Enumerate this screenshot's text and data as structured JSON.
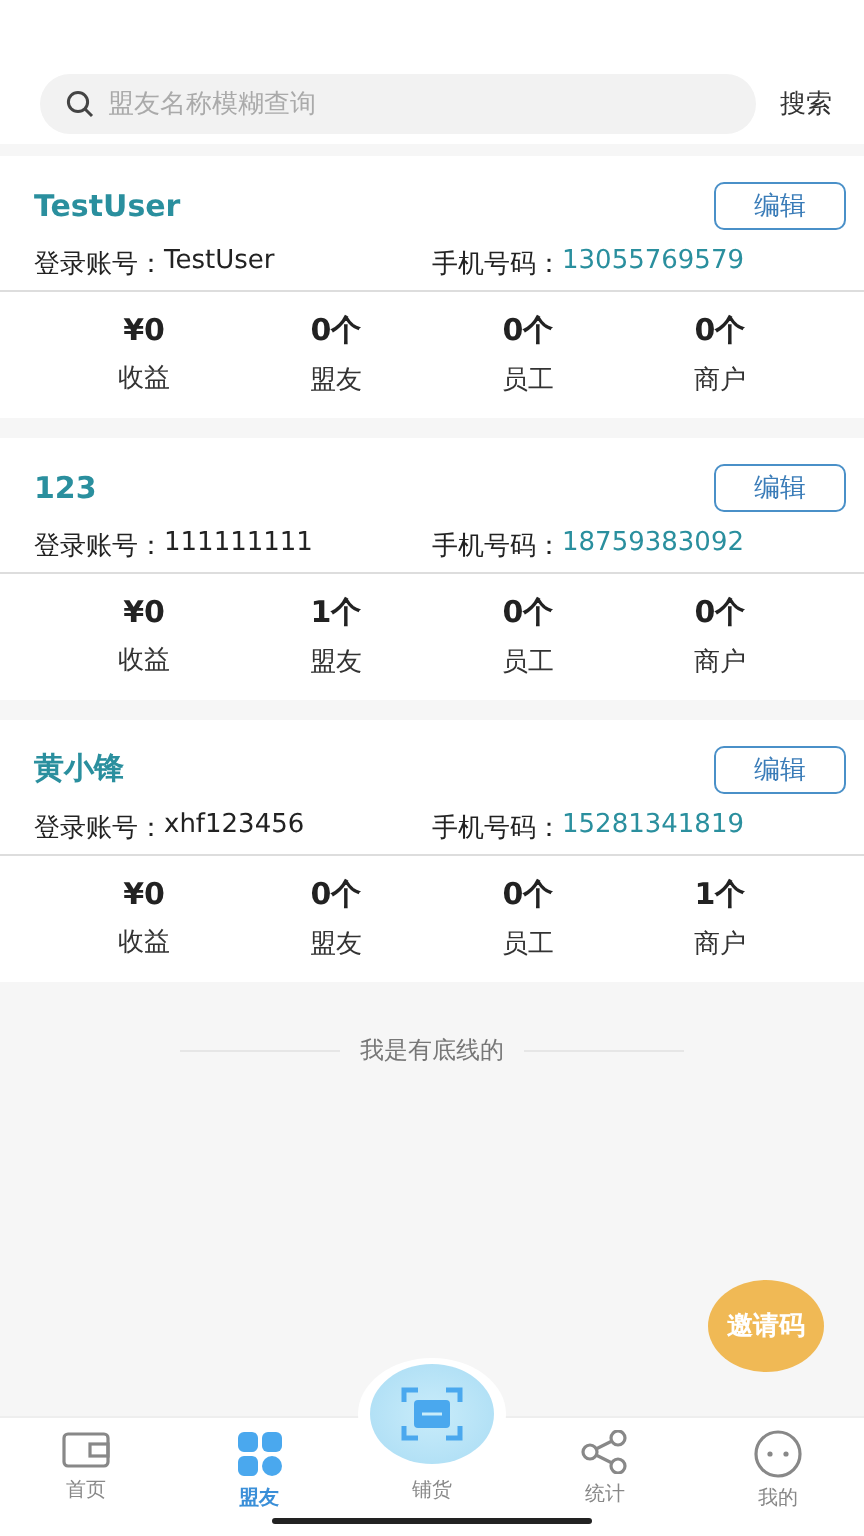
{
  "search": {
    "placeholder": "盟友名称模糊查询",
    "button": "搜索"
  },
  "partners": [
    {
      "name": "TestUser",
      "edit": "编辑",
      "account_label": "登录账号：",
      "account": "TestUser",
      "phone_label": "手机号码：",
      "phone": "13055769579",
      "stats": [
        {
          "value": "¥0",
          "label": "收益"
        },
        {
          "value": "0个",
          "label": "盟友"
        },
        {
          "value": "0个",
          "label": "员工"
        },
        {
          "value": "0个",
          "label": "商户"
        }
      ]
    },
    {
      "name": "123",
      "edit": "编辑",
      "account_label": "登录账号：",
      "account": "111111111",
      "phone_label": "手机号码：",
      "phone": "18759383092",
      "stats": [
        {
          "value": "¥0",
          "label": "收益"
        },
        {
          "value": "1个",
          "label": "盟友"
        },
        {
          "value": "0个",
          "label": "员工"
        },
        {
          "value": "0个",
          "label": "商户"
        }
      ]
    },
    {
      "name": "黄小锋",
      "edit": "编辑",
      "account_label": "登录账号：",
      "account": "xhf123456",
      "phone_label": "手机号码：",
      "phone": "15281341819",
      "stats": [
        {
          "value": "¥0",
          "label": "收益"
        },
        {
          "value": "0个",
          "label": "盟友"
        },
        {
          "value": "0个",
          "label": "员工"
        },
        {
          "value": "1个",
          "label": "商户"
        }
      ]
    }
  ],
  "end_note": "我是有底线的",
  "invite_button": "邀请码",
  "tabs": [
    {
      "kind": "wallet",
      "label": "首页",
      "selected": false
    },
    {
      "kind": "grid",
      "label": "盟友",
      "selected": true
    },
    {
      "kind": "scan",
      "label": "铺货",
      "selected": false
    },
    {
      "kind": "share",
      "label": "统计",
      "selected": false
    },
    {
      "kind": "chat",
      "label": "我的",
      "selected": false
    }
  ]
}
